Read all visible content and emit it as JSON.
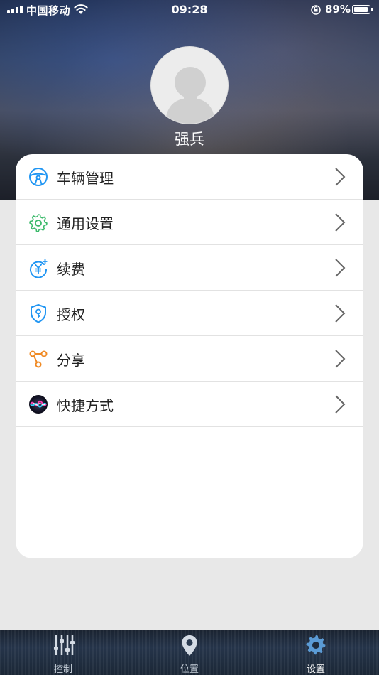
{
  "status_bar": {
    "carrier": "中国移动",
    "time": "09:28",
    "battery_percent": "89%",
    "battery_level": 0.89
  },
  "profile": {
    "username": "强兵"
  },
  "menu": {
    "items": [
      {
        "label": "车辆管理",
        "icon": "steering-wheel-icon",
        "color": "#2196f3"
      },
      {
        "label": "通用设置",
        "icon": "gear-icon",
        "color": "#3cba6b"
      },
      {
        "label": "续费",
        "icon": "yuan-renew-icon",
        "color": "#2196f3"
      },
      {
        "label": "授权",
        "icon": "shield-key-icon",
        "color": "#2196f3"
      },
      {
        "label": "分享",
        "icon": "share-icon",
        "color": "#f08a24"
      },
      {
        "label": "快捷方式",
        "icon": "siri-icon",
        "color": "#7a4cff"
      }
    ]
  },
  "tabbar": {
    "tabs": [
      {
        "label": "控制",
        "icon": "sliders-icon",
        "active": false
      },
      {
        "label": "位置",
        "icon": "location-pin-icon",
        "active": false
      },
      {
        "label": "设置",
        "icon": "gear-icon",
        "active": true
      }
    ],
    "active_color": "#5b9bd5"
  }
}
